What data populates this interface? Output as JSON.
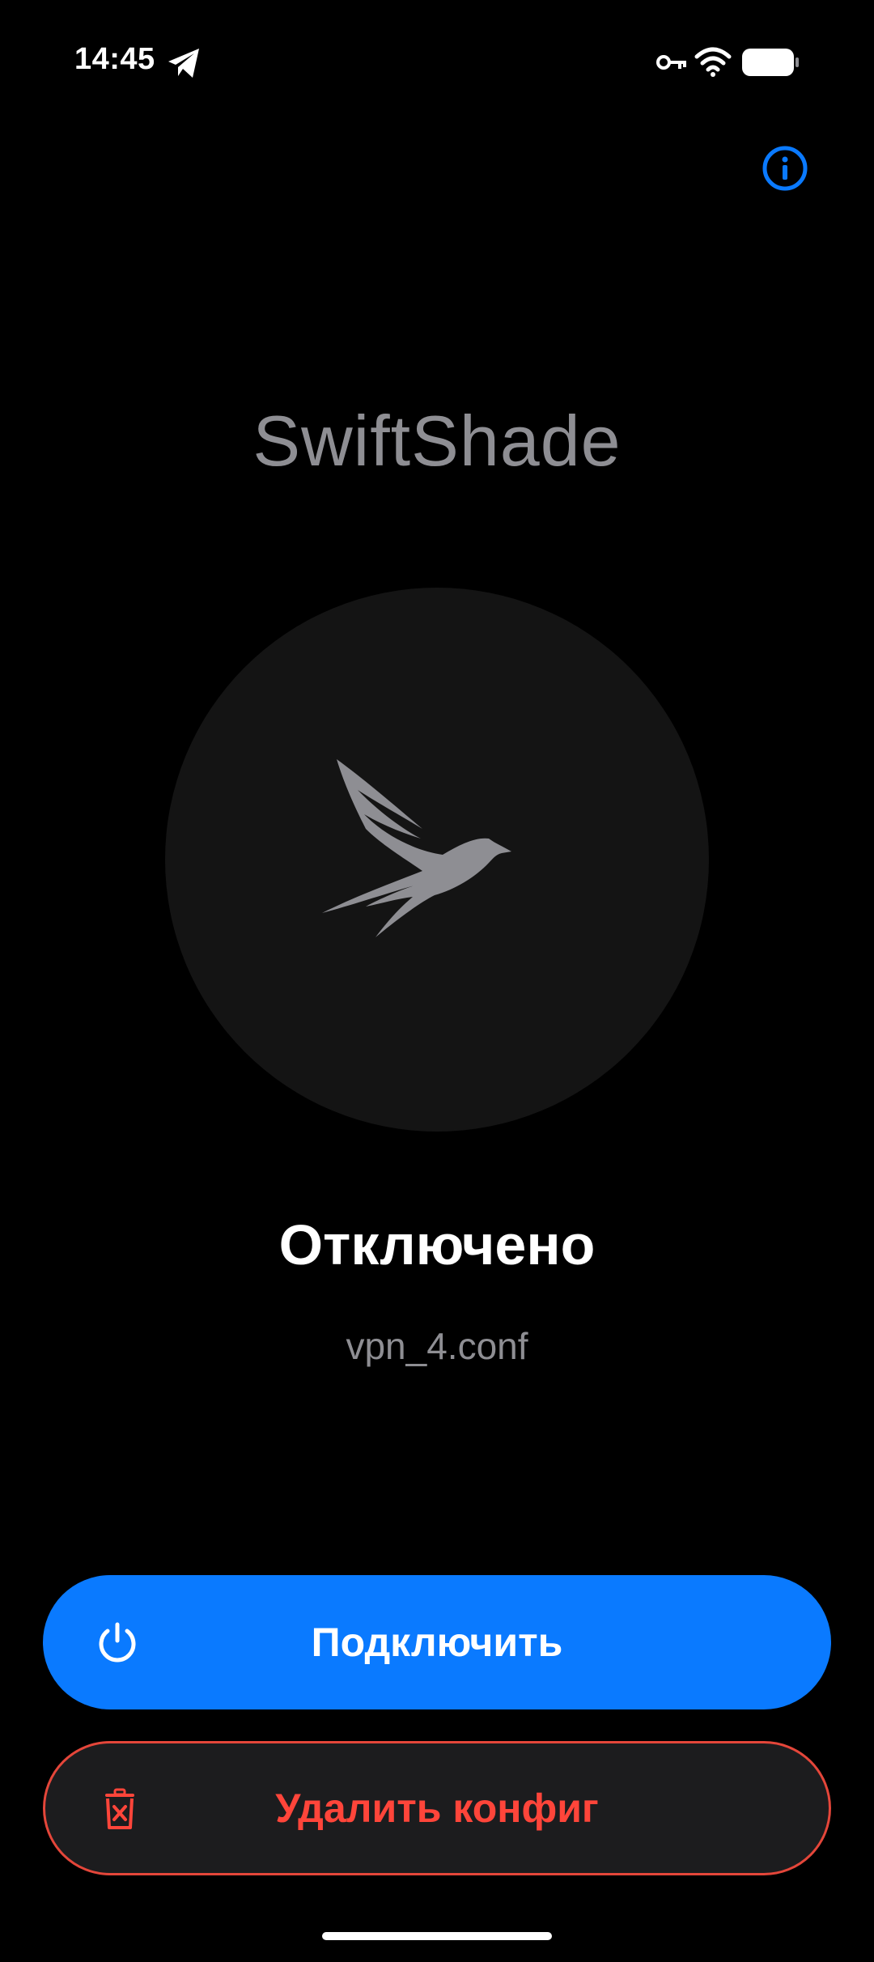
{
  "status_bar": {
    "time": "14:45",
    "icons": [
      "telegram-icon",
      "vpn-key-icon",
      "wifi-icon",
      "battery-icon"
    ]
  },
  "header": {
    "info_icon": "info-icon"
  },
  "app": {
    "title": "SwiftShade",
    "logo_icon": "swift-bird-icon"
  },
  "connection": {
    "status": "Отключено",
    "config_name": "vpn_4.conf"
  },
  "actions": {
    "connect_label": "Подключить",
    "connect_icon": "power-icon",
    "delete_label": "Удалить конфиг",
    "delete_icon": "trash-icon"
  },
  "colors": {
    "accent": "#0a7aff",
    "destructive": "#ff453a",
    "muted_text": "#8e8e93",
    "circle_bg": "#141414",
    "button_dark_bg": "#1c1c1e"
  }
}
